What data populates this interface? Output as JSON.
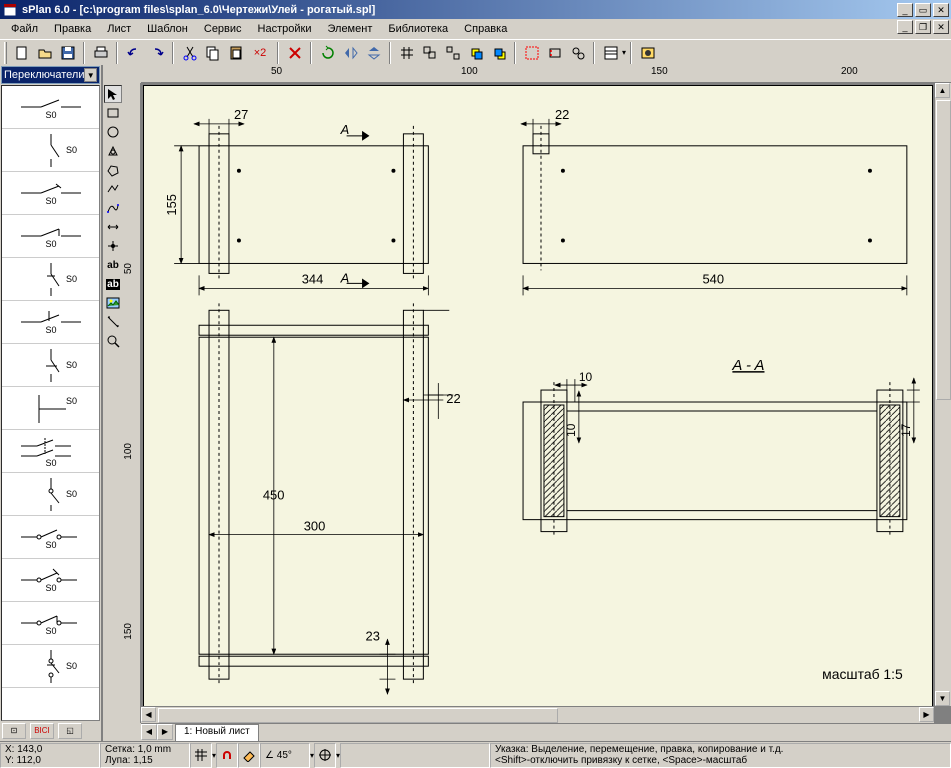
{
  "titlebar": {
    "app": "sPlan 6.0",
    "doc": "[c:\\program files\\splan_6.0\\Чертежи\\Улей - рогатый.spl]"
  },
  "menu": {
    "items": [
      "Файл",
      "Правка",
      "Лист",
      "Шаблон",
      "Сервис",
      "Настройки",
      "Элемент",
      "Библиотека",
      "Справка"
    ]
  },
  "toolbar": {
    "paste_mult": "×2"
  },
  "library": {
    "selected": "Переключатели",
    "labels": [
      "S0",
      "S0",
      "S0",
      "S0",
      "S0",
      "S0",
      "S0",
      "S0",
      "S0",
      "S0",
      "S0",
      "S0",
      "S0",
      "S0"
    ]
  },
  "ruler": {
    "h": [
      "50",
      "100",
      "150",
      "200"
    ],
    "v": [
      "50",
      "100",
      "150"
    ]
  },
  "drawing": {
    "dim_27": "27",
    "dim_22a": "22",
    "dim_155": "155",
    "dim_344": "344",
    "dim_540": "540",
    "section_a_left": "A",
    "section_a_right": "A",
    "dim_22b": "22",
    "dim_450": "450",
    "dim_300": "300",
    "dim_23": "23",
    "dim_10a": "10",
    "dim_10b": "10",
    "dim_17": "17",
    "section_title": "A - A",
    "scale": "масштаб  1:5"
  },
  "tab": {
    "label": "1: Новый лист"
  },
  "status": {
    "x": "X: 143,0",
    "y": "Y: 112,0",
    "grid": "Сетка: 1,0 mm",
    "zoom": "Лупа: 1,15",
    "angle_label": "",
    "angle": "45°",
    "hint": "Указка: Выделение, перемещение, правка, копирование и т.д.",
    "hint2": "<Shift>-отключить привязку к сетке, <Space>-масштаб"
  }
}
